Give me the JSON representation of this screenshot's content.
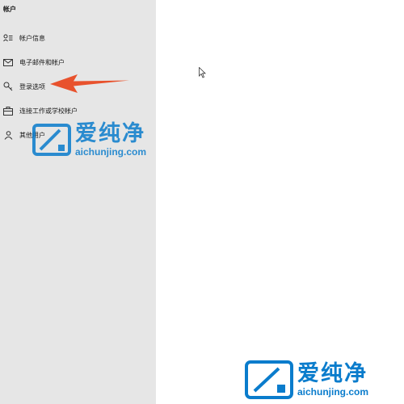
{
  "sidebar": {
    "section_title": "帐户",
    "items": [
      {
        "label": "帐户信息",
        "icon": "account-info-icon"
      },
      {
        "label": "电子邮件和帐户",
        "icon": "mail-icon"
      },
      {
        "label": "登录选项",
        "icon": "key-icon"
      },
      {
        "label": "连接工作或学校帐户",
        "icon": "briefcase-icon"
      },
      {
        "label": "其他用户",
        "icon": "person-icon"
      }
    ]
  },
  "annotation": {
    "arrow_color": "#e8522d"
  },
  "watermark": {
    "brand_cn": "爱纯净",
    "url": "aichunjing.com",
    "color": "#0a7ccc"
  }
}
